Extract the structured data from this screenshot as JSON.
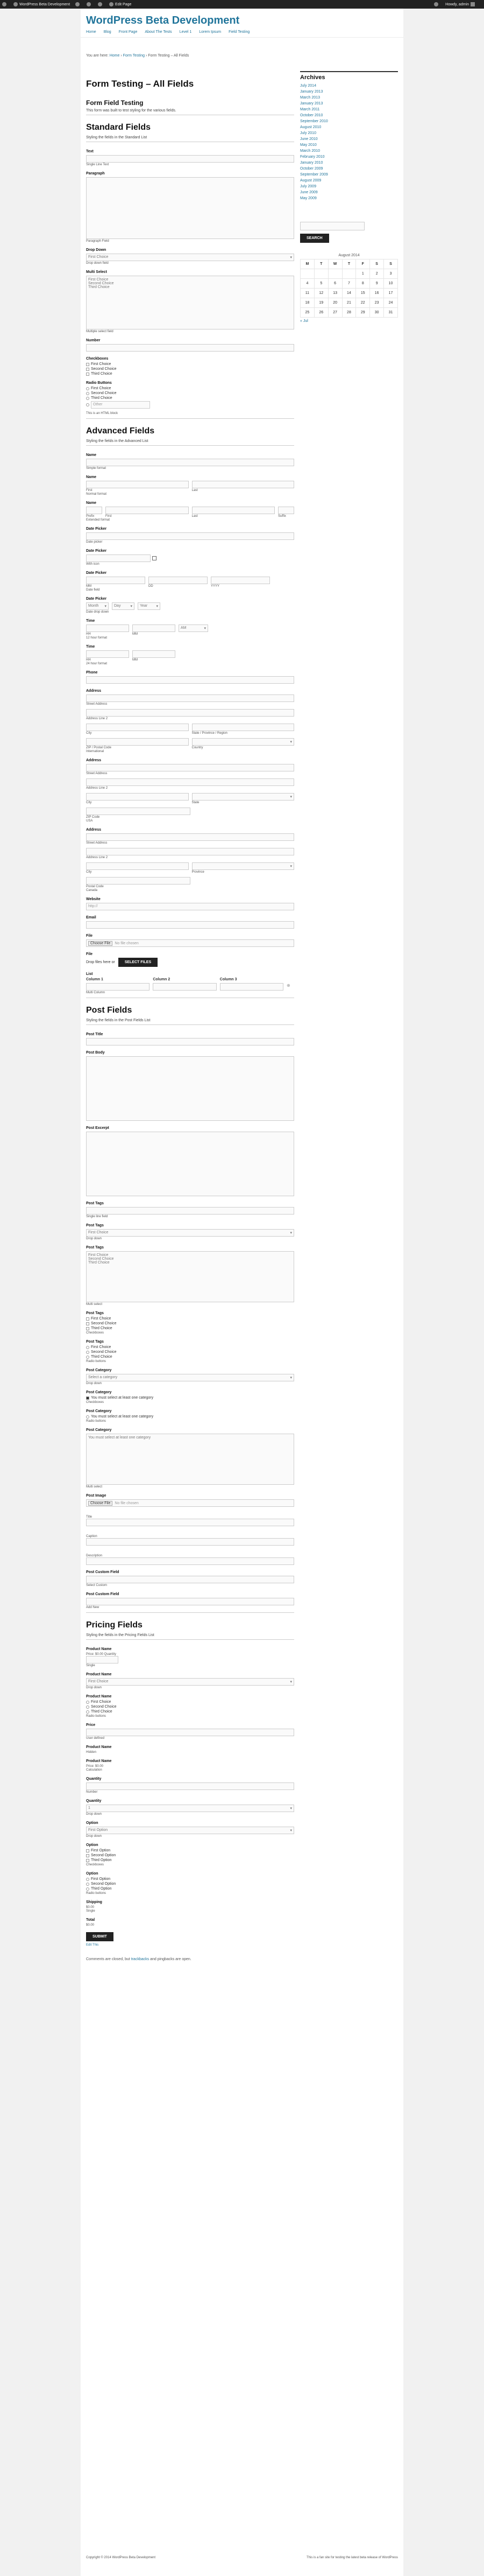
{
  "adminbar": {
    "site": "WordPress Beta Development",
    "customize": "",
    "counter": "",
    "new": "",
    "edit": "Edit Page",
    "search": "",
    "user": "Howdy, admin"
  },
  "site": {
    "title": "WordPress Beta Development"
  },
  "nav": [
    "Home",
    "Blog",
    "Front Page",
    "About The Tests",
    "Level 1",
    "Lorem Ipsum",
    "Field Testing"
  ],
  "breadcrumb": {
    "prefix": "You are here:",
    "home": "Home",
    "parent": "Form Testing",
    "current": "Form Testing – All Fields"
  },
  "page": {
    "title": "Form Testing – All Fields"
  },
  "intro": {
    "heading": "Form Field Testing",
    "desc": "This form was built to test styling for the various fields."
  },
  "standard": {
    "heading": "Standard Fields",
    "desc": "Styling the fields in the Standard List",
    "single_line": "Text",
    "single_line_sub": "Single Line Text",
    "paragraph": "Paragraph",
    "paragraph_sub": "Paragraph Field",
    "dropdown": "Drop Down",
    "dropdown_value": "First Choice",
    "dropdown_sub": "Drop down field",
    "multi": "Multi Select",
    "multi_options": [
      "First Choice",
      "Second Choice",
      "Third Choice"
    ],
    "multi_sub": "Multiple select field",
    "number": "Number",
    "checkboxes": "Checkboxes",
    "checkbox_options": [
      "First Choice",
      "Second Choice",
      "Third Choice"
    ],
    "radios": "Radio Buttons",
    "radio_options": [
      "First Choice",
      "Second Choice",
      "Third Choice",
      "Other"
    ],
    "html_note": "This is an HTML block"
  },
  "advanced": {
    "heading": "Advanced Fields",
    "desc": "Styling the fields in the Advanced List",
    "name": "Name",
    "name_sub": "Simple format",
    "name2": "Name",
    "first": "First",
    "last": "Last",
    "name2_sub": "Normal format",
    "name3": "Name",
    "prefix": "Prefix",
    "first3": "First",
    "last3": "Last",
    "suffix": "Suffix",
    "name3_sub": "Extended format",
    "date1": "Date Picker",
    "date1_sub": "Date picker",
    "date2": "Date Picker",
    "date2_sub": "With icon",
    "date3": "Date Picker",
    "mm": "MM",
    "dd": "DD",
    "yyyy": "YYYY",
    "date3_sub": "Date field",
    "date4": "Date Picker",
    "month": "Month",
    "day": "Day",
    "year": "Year",
    "date4_sub": "Date drop down",
    "time1": "Time",
    "hh": "HH",
    "min": "MM",
    "ampm": "AM",
    "time1_sub": "12 hour format",
    "time2": "Time",
    "hh2": "HH",
    "mm2": "MM",
    "time2_sub": "24 hour format",
    "phone": "Phone",
    "address": "Address",
    "street": "Street Address",
    "line2": "Address Line 2",
    "city": "City",
    "state": "State / Province / Region",
    "zip": "ZIP / Postal Code",
    "country": "Country",
    "address_sub": "International",
    "address2": "Address",
    "street2": "Street Address",
    "line22": "Address Line 2",
    "city2": "City",
    "state2": "State",
    "zip2": "ZIP Code",
    "address2_sub": "USA",
    "address3": "Address",
    "street3": "Street Address",
    "line23": "Address Line 2",
    "city3": "City",
    "province": "Province",
    "postal": "Postal Code",
    "address3_sub": "Canada",
    "website": "Website",
    "website_value": "http://",
    "email": "Email",
    "file": "File",
    "file_button": "Choose File",
    "file_none": "No file chosen",
    "drop": "Drop files here",
    "or": "or",
    "select_files": "SELECT FILES",
    "list": "List",
    "list_cols": [
      "Column 1",
      "Column 2",
      "Column 3"
    ],
    "list_sub": "Multi Column"
  },
  "post": {
    "heading": "Post Fields",
    "desc": "Styling the fields in the Post Fields List",
    "title": "Post Title",
    "body": "Post Body",
    "excerpt": "Post Excerpt",
    "tags1": "Post Tags",
    "tags1_sub": "Single line field",
    "tags2": "Post Tags",
    "tags2_value": "First Choice",
    "tags2_sub": "Drop down",
    "tags3": "Post Tags",
    "tags3_options": [
      "First Choice",
      "Second Choice",
      "Third Choice"
    ],
    "tags3_sub": "Multi select",
    "tags4": "Post Tags",
    "tags4_options": [
      "First Choice",
      "Second Choice",
      "Third Choice"
    ],
    "tags4_sub": "Checkboxes",
    "tags5": "Post Tags",
    "tags5_options": [
      "First Choice",
      "Second Choice",
      "Third Choice"
    ],
    "tags5_sub": "Radio buttons",
    "cat1": "Post Category",
    "cat1_value": "Select a category",
    "cat1_sub": "Drop down",
    "cat2": "Post Category",
    "cat2_option": "You must select at least one category",
    "cat2_sub": "Checkboxes",
    "cat3": "Post Category",
    "cat3_option": "You must select at least one category",
    "cat3_sub": "Radio buttons",
    "cat4": "Post Category",
    "cat4_option": "You must select at least one category",
    "cat4_sub": "Multi select",
    "image": "Post Image",
    "image_button": "Choose File",
    "image_none": "No file chosen",
    "img_title": "Title",
    "img_caption": "Caption",
    "img_desc": "Description",
    "custom1": "Post Custom Field",
    "custom1_sub": "Select Custom",
    "custom2": "Post Custom Field",
    "custom2_sub": "Add New"
  },
  "pricing": {
    "heading": "Pricing Fields",
    "desc": "Styling the fields in the Pricing Fields List",
    "p1": "Product Name",
    "p1_price": "Price: $0.00 Quantity",
    "p1_sub": "Single",
    "p2": "Product Name",
    "p2_value": "First Choice",
    "p2_sub": "Drop down",
    "p3": "Product Name",
    "p3_options": [
      "First Choice",
      "Second Choice",
      "Third Choice"
    ],
    "p3_sub": "Radio buttons",
    "p4": "Price",
    "p4_sub": "User defined",
    "p5": "Product Name",
    "p5_sub": "Hidden",
    "p6": "Product Name",
    "p6_price": "Price: $0.00",
    "p6_sub": "Calculation",
    "qty1": "Quantity",
    "qty1_sub": "Number",
    "qty2": "Quantity",
    "qty2_value": "1",
    "qty2_sub": "Drop down",
    "opt1": "Option",
    "opt1_value": "First Option",
    "opt1_sub": "Drop down",
    "opt2": "Option",
    "opt2_options": [
      "First Option",
      "Second Option",
      "Third Option"
    ],
    "opt2_sub": "Checkboxes",
    "opt3": "Option",
    "opt3_options": [
      "First Option",
      "Second Option",
      "Third Option"
    ],
    "opt3_sub": "Radio buttons",
    "shipping": "Shipping",
    "shipping_value": "$0.00",
    "shipping_sub": "Single",
    "total": "Total",
    "total_value": "$0.00",
    "submit": "SUBMIT",
    "edit": "Edit This"
  },
  "comments": {
    "text": "Comments are closed, but",
    "trackbacks": "trackbacks",
    "text2": "and pingbacks are open."
  },
  "sidebar": {
    "archives_title": "Archives",
    "archives": [
      "July 2014",
      "January 2013",
      "March 2013",
      "January 2013",
      "March 2011",
      "October 2010",
      "September 2010",
      "August 2010",
      "July 2010",
      "June 2010",
      "May 2010",
      "March 2010",
      "February 2010",
      "January 2010",
      "October 2009",
      "September 2009",
      "August 2009",
      "July 2009",
      "June 2009",
      "May 2009"
    ],
    "search_button": "SEARCH",
    "cal_caption": "August 2014",
    "cal_head": [
      "M",
      "T",
      "W",
      "T",
      "F",
      "S",
      "S"
    ],
    "cal_rows": [
      [
        "",
        "",
        "",
        "",
        "1",
        "2",
        "3"
      ],
      [
        "4",
        "5",
        "6",
        "7",
        "8",
        "9",
        "10"
      ],
      [
        "11",
        "12",
        "13",
        "14",
        "15",
        "16",
        "17"
      ],
      [
        "18",
        "19",
        "20",
        "21",
        "22",
        "23",
        "24"
      ],
      [
        "25",
        "26",
        "27",
        "28",
        "29",
        "30",
        "31"
      ]
    ],
    "cal_prev": "« Jul"
  },
  "footer": {
    "left": "Copyright © 2014 WordPress Beta Development",
    "right": "This is a fan site for testing the latest beta release of WordPress"
  }
}
